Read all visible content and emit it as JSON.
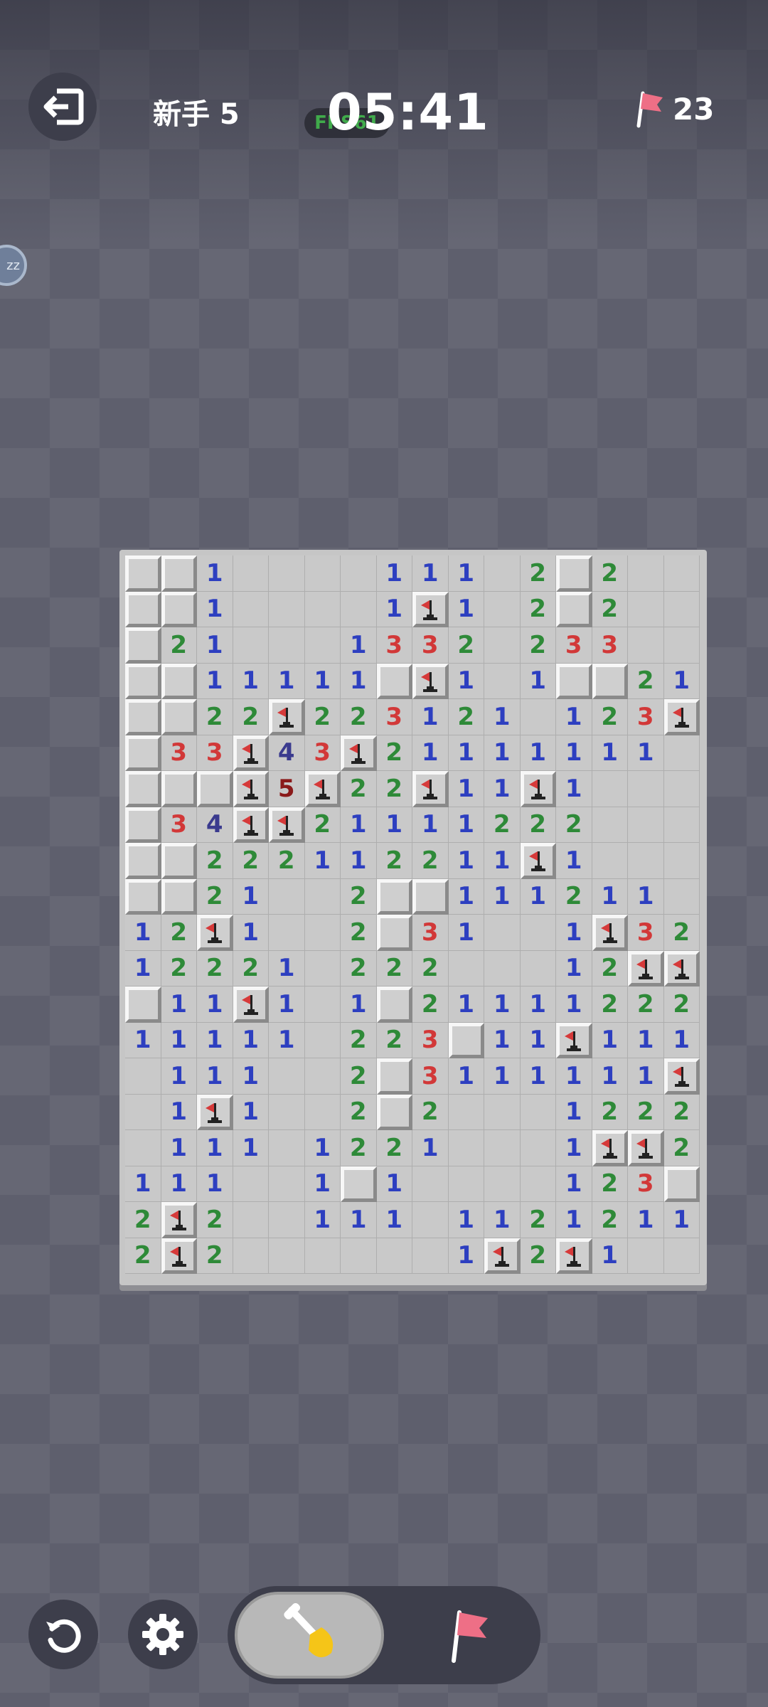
{
  "header": {
    "level": "新手 5",
    "timer": "05:41",
    "fps": "FPS61",
    "flags_remaining": "23"
  },
  "side_badge": "zz",
  "colors": {
    "n1": "#2d3fc0",
    "n2": "#2e8a38",
    "n3": "#d23838",
    "n4": "#3a3a8e",
    "n5": "#8a1a1a",
    "flag_red": "#d63a3a",
    "board": "#c9c9c9"
  },
  "icons": {
    "exit": "exit-icon",
    "flag": "flag-icon",
    "undo": "undo-icon",
    "settings": "gear-icon",
    "dig": "shovel-icon"
  },
  "board": {
    "cols": 16,
    "rows_count": 20,
    "legend": "H = unrevealed, F = flagged, . = empty, digit = adjacent mines",
    "rows": [
      "HH1....111.2H2..",
      "HH1....1F1.2H2..",
      "H21...1332.233..",
      "HH11111HF1.1HH21",
      "HH22F223121.123F1",
      "H33F43F21111111",
      "HHHF5F22F11F1...",
      "H34FF2111122 2...",
      "HH2221122 11F1...",
      "HH21..2HH111211.",
      "12F1..2H31..1F32",
      "12221.222...12FF",
      "H11F1.1H211112 22",
      "11111.223H11F111",
      ".111..2H3111111F",
      ".1F1..2H2...1222",
      ".111.1221...1FF21",
      "111..1H1....123H1",
      "2F2..111.11212 11",
      "2F2......1F2F1.."
    ]
  }
}
